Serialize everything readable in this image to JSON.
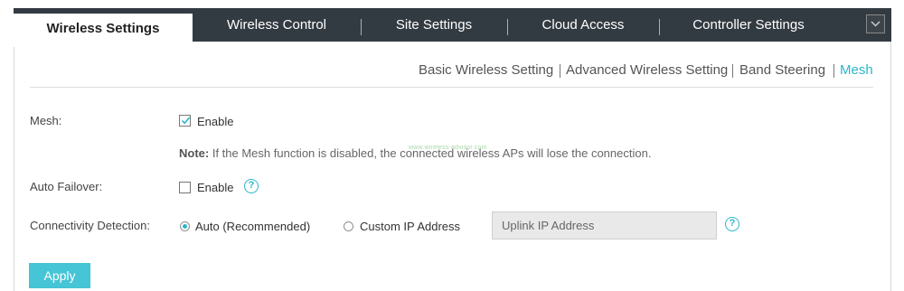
{
  "tabs": [
    {
      "label": "Wireless Settings",
      "active": true
    },
    {
      "label": "Wireless Control",
      "active": false
    },
    {
      "label": "Site Settings",
      "active": false
    },
    {
      "label": "Cloud Access",
      "active": false
    },
    {
      "label": "Controller Settings",
      "active": false
    }
  ],
  "subnav": [
    {
      "label": "Basic Wireless Setting",
      "active": false
    },
    {
      "label": "Advanced Wireless Setting",
      "active": false
    },
    {
      "label": "Band Steering",
      "active": false
    },
    {
      "label": "Mesh",
      "active": true
    }
  ],
  "form": {
    "mesh": {
      "label": "Mesh:",
      "checkbox_label": "Enable",
      "checked": true
    },
    "note": {
      "prefix": "Note:",
      "text": " If the Mesh function is disabled, the connected wireless APs will lose the connection."
    },
    "watermark": "www.wireless-advisor.com",
    "auto_failover": {
      "label": "Auto Failover:",
      "checkbox_label": "Enable",
      "checked": false
    },
    "connectivity": {
      "label": "Connectivity Detection:",
      "options": [
        {
          "label": "Auto (Recommended)",
          "selected": true
        },
        {
          "label": "Custom IP Address",
          "selected": false
        }
      ],
      "ip_placeholder": "Uplink IP Address",
      "ip_value": ""
    },
    "apply_label": "Apply"
  },
  "colors": {
    "accent": "#2cb7c9",
    "tabbar_bg": "#333b42",
    "apply_bg": "#45c5d6"
  }
}
